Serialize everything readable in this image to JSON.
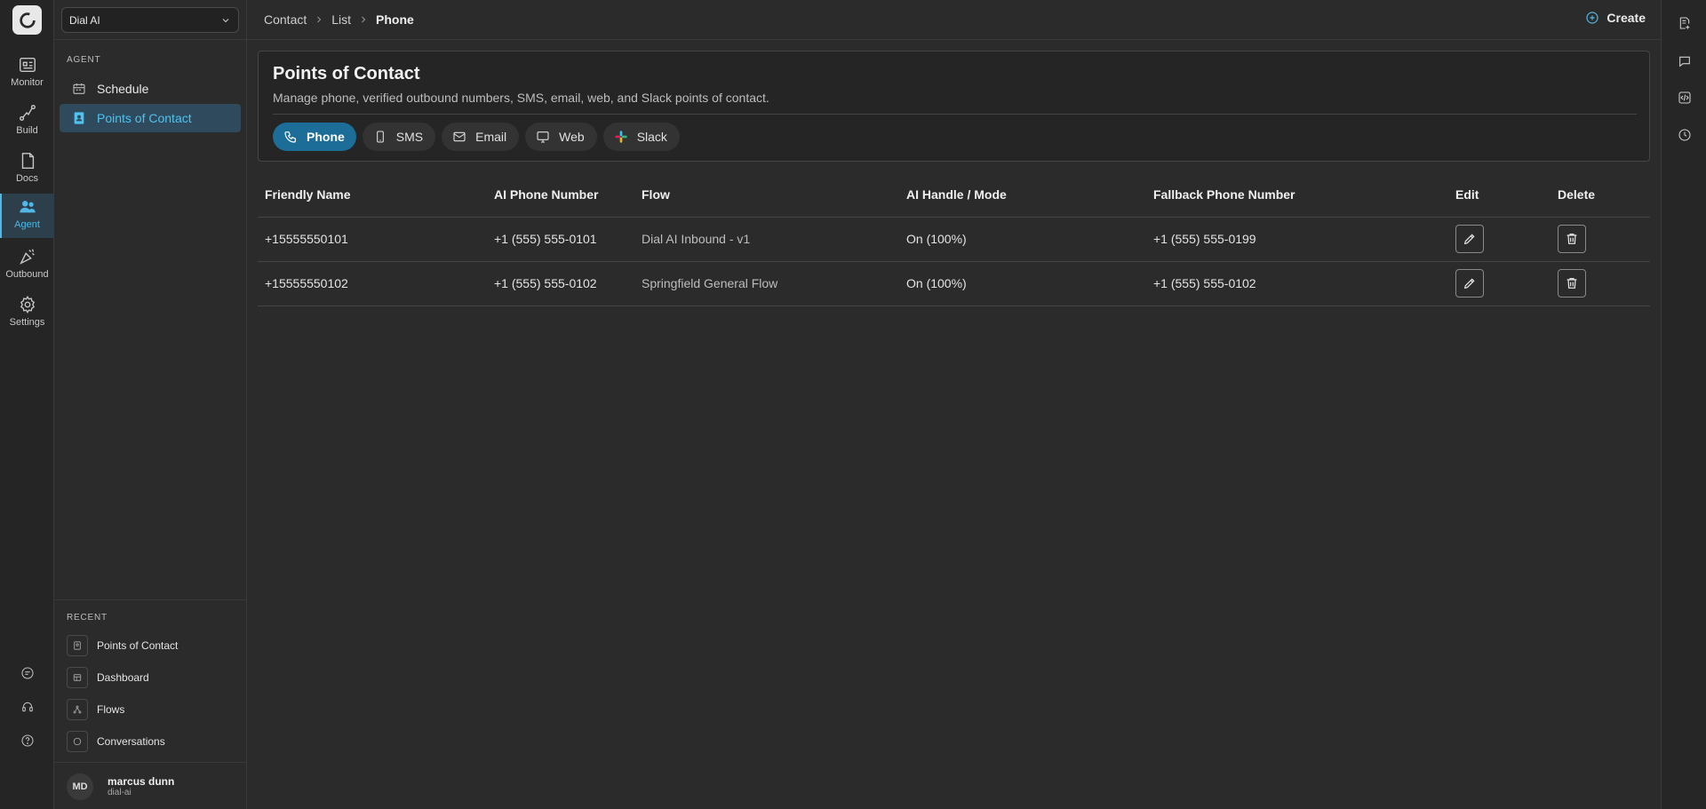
{
  "rail": {
    "items": [
      {
        "label": "Monitor",
        "icon": "monitor-icon"
      },
      {
        "label": "Build",
        "icon": "build-icon"
      },
      {
        "label": "Docs",
        "icon": "docs-icon"
      },
      {
        "label": "Agent",
        "icon": "agent-icon",
        "active": true
      },
      {
        "label": "Outbound",
        "icon": "outbound-icon"
      },
      {
        "label": "Settings",
        "icon": "gear-icon"
      }
    ],
    "bottom_icons": [
      "chat-icon",
      "headset-icon",
      "help-icon"
    ]
  },
  "sidebar": {
    "org_select": "Dial AI",
    "section_label": "AGENT",
    "items": [
      {
        "label": "Schedule",
        "icon": "calendar-icon"
      },
      {
        "label": "Points of Contact",
        "icon": "contact-icon",
        "active": true
      }
    ],
    "recent_label": "RECENT",
    "recent": [
      {
        "label": "Points of Contact",
        "icon": "contact-icon"
      },
      {
        "label": "Dashboard",
        "icon": "dashboard-icon"
      },
      {
        "label": "Flows",
        "icon": "flow-icon"
      },
      {
        "label": "Conversations",
        "icon": "chat-icon"
      }
    ],
    "user": {
      "initials": "MD",
      "name": "marcus dunn",
      "org": "dial-ai"
    }
  },
  "header": {
    "breadcrumbs": [
      "Contact",
      "List",
      "Phone"
    ],
    "create_label": "Create"
  },
  "right_rail": [
    "new-doc-icon",
    "chat-icon",
    "code-icon",
    "history-icon"
  ],
  "card": {
    "title": "Points of Contact",
    "description": "Manage phone, verified outbound numbers, SMS, email, web, and Slack points of contact.",
    "tabs": [
      {
        "label": "Phone",
        "icon": "phone-icon",
        "active": true
      },
      {
        "label": "SMS",
        "icon": "mobile-icon"
      },
      {
        "label": "Email",
        "icon": "mail-icon"
      },
      {
        "label": "Web",
        "icon": "monitor-icon"
      },
      {
        "label": "Slack",
        "icon": "slack-icon"
      }
    ]
  },
  "table": {
    "columns": [
      "Friendly Name",
      "AI Phone Number",
      "Flow",
      "AI Handle / Mode",
      "Fallback Phone Number",
      "Edit",
      "Delete"
    ],
    "rows": [
      [
        "+15555550101",
        "+1 (555) 555-0101",
        "Dial AI Inbound - v1",
        "On (100%)",
        "+1 (555) 555-0199"
      ],
      [
        "+15555550102",
        "+1 (555) 555-0102",
        "Springfield General Flow",
        "On (100%)",
        "+1 (555) 555-0102"
      ]
    ]
  },
  "colors": {
    "accent": "#4fb8e6",
    "active_pill": "#1d6d99",
    "background": "#2b2b2b"
  }
}
